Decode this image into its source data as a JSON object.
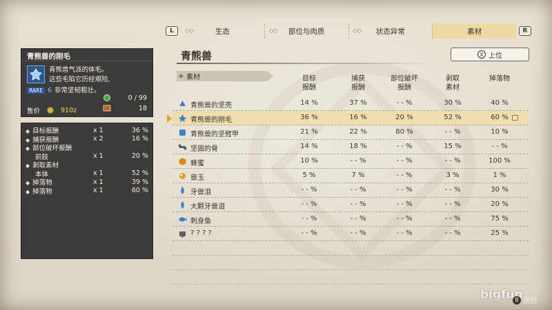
{
  "tabs": {
    "left_shoulder": "L",
    "right_shoulder": "R",
    "items": [
      {
        "label": "生态",
        "active": false
      },
      {
        "label": "部位与肉质",
        "active": false
      },
      {
        "label": "状态异常",
        "active": false
      },
      {
        "label": "素材",
        "active": true
      }
    ]
  },
  "item": {
    "name": "青熊兽的刚毛",
    "description_line1": "青熊兽气派的体毛。",
    "description_line2": "这些毛陷它历经艰险,",
    "rare_label": "RARE",
    "rare_value": "6",
    "description_line3": "非常坚韧粗壮。",
    "quantity": "0 / 99",
    "stock": "18",
    "price_label": "售价",
    "price_value": "910z"
  },
  "rates": [
    {
      "name": "目标报酬",
      "mult": "x 1",
      "pct": "36 %",
      "bullet": true
    },
    {
      "name": "捕获报酬",
      "mult": "x 2",
      "pct": "16 %",
      "bullet": true
    },
    {
      "name": "部位破坏报酬",
      "mult": "",
      "pct": "",
      "bullet": true
    },
    {
      "name": "前肢",
      "mult": "x 1",
      "pct": "20 %",
      "bullet": false,
      "indent": true
    },
    {
      "name": "剥取素材",
      "mult": "",
      "pct": "",
      "bullet": true
    },
    {
      "name": "本体",
      "mult": "x 1",
      "pct": "52 %",
      "bullet": false,
      "indent": true
    },
    {
      "name": "掉落物",
      "mult": "x 1",
      "pct": "39 %",
      "bullet": true
    },
    {
      "name": "掉落物",
      "mult": "x 1",
      "pct": "60 %",
      "bullet": true
    }
  ],
  "monster": {
    "name": "青熊兽"
  },
  "back_button": {
    "key": "X",
    "label": "上位"
  },
  "table": {
    "section_label": "素材",
    "columns": [
      {
        "line1": "目标",
        "line2": "报酬"
      },
      {
        "line1": "捕获",
        "line2": "报酬"
      },
      {
        "line1": "部位破坏",
        "line2": "报酬"
      },
      {
        "line1": "剥取",
        "line2": "素材"
      },
      {
        "line1": "掉落物",
        "line2": ""
      }
    ],
    "rows": [
      {
        "icon": "shell-icon",
        "color": "#3e7fc4",
        "name": "青熊兽的坚壳",
        "v": [
          "14 %",
          "37 %",
          "- - %",
          "30 %",
          "40 %"
        ],
        "selected": false
      },
      {
        "icon": "fur-icon",
        "color": "#3e7fc4",
        "name": "青熊兽的刚毛",
        "v": [
          "36 %",
          "16 %",
          "20 %",
          "52 %",
          "60 %"
        ],
        "selected": true
      },
      {
        "icon": "armor-icon",
        "color": "#3e7fc4",
        "name": "青熊兽的坚臂甲",
        "v": [
          "21 %",
          "22 %",
          "80 %",
          "- - %",
          "10 %"
        ],
        "selected": false
      },
      {
        "icon": "bone-icon",
        "color": "#55606a",
        "name": "坚固的骨",
        "v": [
          "14 %",
          "18 %",
          "- - %",
          "15 %",
          "- - %"
        ],
        "selected": false
      },
      {
        "icon": "honey-icon",
        "color": "#d88a1a",
        "name": "蜂蜜",
        "v": [
          "10 %",
          "- - %",
          "- - %",
          "- - %",
          "100 %"
        ],
        "selected": false
      },
      {
        "icon": "orb-icon",
        "color": "#d8a21a",
        "name": "兽玉",
        "v": [
          "5 %",
          "7 %",
          "- - %",
          "3 %",
          "1 %"
        ],
        "selected": false
      },
      {
        "icon": "tear-icon",
        "color": "#3e7fc4",
        "name": "牙兽泪",
        "v": [
          "- - %",
          "- - %",
          "- - %",
          "- - %",
          "30 %"
        ],
        "selected": false
      },
      {
        "icon": "tear-icon",
        "color": "#3e7fc4",
        "name": "大颗牙兽泪",
        "v": [
          "- - %",
          "- - %",
          "- - %",
          "- - %",
          "20 %"
        ],
        "selected": false
      },
      {
        "icon": "fish-icon",
        "color": "#3e7fc4",
        "name": "刺身鱼",
        "v": [
          "- - %",
          "- - %",
          "- - %",
          "- - %",
          "75 %"
        ],
        "selected": false
      },
      {
        "icon": "unknown-icon",
        "color": "#55606a",
        "name": "? ? ? ?",
        "v": [
          "- - %",
          "- - %",
          "- - %",
          "- - %",
          "25 %"
        ],
        "selected": false
      }
    ]
  },
  "footer": {
    "key": "B",
    "label": "返回",
    "watermark": "bigfun"
  }
}
